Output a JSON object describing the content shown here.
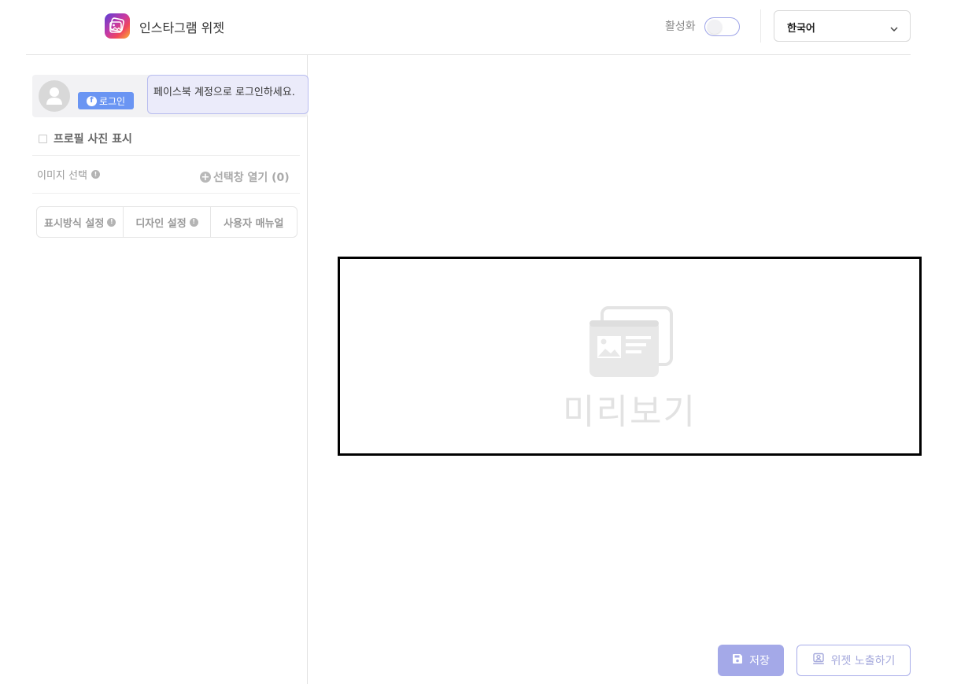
{
  "header": {
    "app_title": "인스타그램 위젯",
    "toggle_label": "활성화",
    "toggle_on": false,
    "language": "한국어"
  },
  "login": {
    "button_label": "로그인",
    "tooltip": "페이스북 계정으로 로그인하세요."
  },
  "profile": {
    "checkbox_label": "프로필 사진 표시",
    "checked": false
  },
  "image_select": {
    "label": "이미지 선택",
    "open_button": "선택창 열기 (0)"
  },
  "tabs": [
    {
      "label": "표시방식 설정"
    },
    {
      "label": "디자인 설정"
    },
    {
      "label": "사용자 매뉴얼"
    }
  ],
  "preview": {
    "text": "미리보기"
  },
  "actions": {
    "save_label": "저장",
    "expose_label": "위젯 노출하기"
  },
  "colors": {
    "accent": "#a4a9e8",
    "facebook": "#6a95f3",
    "tooltip_bg": "#ebebfa"
  }
}
